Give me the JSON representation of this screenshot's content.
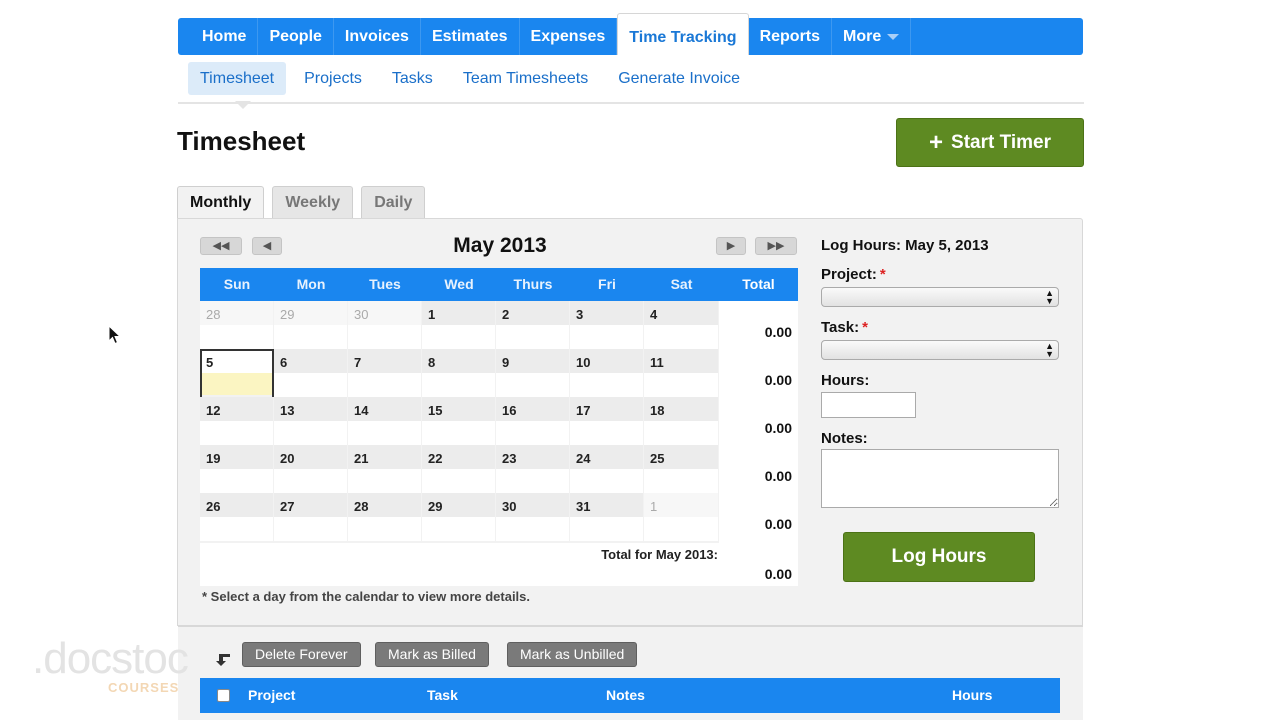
{
  "nav": {
    "items": [
      {
        "label": "Home"
      },
      {
        "label": "People"
      },
      {
        "label": "Invoices"
      },
      {
        "label": "Estimates"
      },
      {
        "label": "Expenses"
      },
      {
        "label": "Time Tracking"
      },
      {
        "label": "Reports"
      },
      {
        "label": "More"
      }
    ],
    "active": "Time Tracking"
  },
  "subnav": {
    "items": [
      {
        "label": "Timesheet"
      },
      {
        "label": "Projects"
      },
      {
        "label": "Tasks"
      },
      {
        "label": "Team Timesheets"
      },
      {
        "label": "Generate Invoice"
      }
    ],
    "active": "Timesheet"
  },
  "page": {
    "title": "Timesheet",
    "start_timer_label": "Start Timer"
  },
  "view_tabs": {
    "monthly": "Monthly",
    "weekly": "Weekly",
    "daily": "Daily",
    "active": "Monthly"
  },
  "calendar": {
    "month_title": "May 2013",
    "prev_year_glyph": "◀◀",
    "prev_month_glyph": "◀",
    "next_month_glyph": "▶",
    "next_year_glyph": "▶▶",
    "headers": [
      "Sun",
      "Mon",
      "Tues",
      "Wed",
      "Thurs",
      "Fri",
      "Sat",
      "Total"
    ],
    "weeks": [
      {
        "days": [
          "28",
          "29",
          "30",
          "1",
          "2",
          "3",
          "4"
        ],
        "total": "0.00"
      },
      {
        "days": [
          "5",
          "6",
          "7",
          "8",
          "9",
          "10",
          "11"
        ],
        "total": "0.00"
      },
      {
        "days": [
          "12",
          "13",
          "14",
          "15",
          "16",
          "17",
          "18"
        ],
        "total": "0.00"
      },
      {
        "days": [
          "19",
          "20",
          "21",
          "22",
          "23",
          "24",
          "25"
        ],
        "total": "0.00"
      },
      {
        "days": [
          "26",
          "27",
          "28",
          "29",
          "30",
          "31",
          "1"
        ],
        "total": "0.00"
      }
    ],
    "selected_day": "5",
    "month_total_label": "Total for May 2013:",
    "month_total_value": "0.00",
    "note": "* Select a day from the calendar to view more details."
  },
  "log_form": {
    "title": "Log Hours: May 5, 2013",
    "project_label": "Project:",
    "task_label": "Task:",
    "hours_label": "Hours:",
    "notes_label": "Notes:",
    "required_mark": "*",
    "project_value": "",
    "task_value": "",
    "hours_value": "",
    "notes_value": "",
    "submit_label": "Log Hours"
  },
  "bulk_actions": {
    "delete_label": "Delete Forever",
    "billed_label": "Mark as Billed",
    "unbilled_label": "Mark as Unbilled"
  },
  "entries_table": {
    "columns": [
      "Project",
      "Task",
      "Notes",
      "Hours"
    ]
  },
  "watermark": {
    "brand": ".docstoc",
    "sub": "COURSES"
  },
  "colors": {
    "nav_blue": "#1a86ef",
    "action_green": "#5e8a22",
    "selected_day_fill": "#fbf5c2",
    "required_red": "#dd2222"
  }
}
